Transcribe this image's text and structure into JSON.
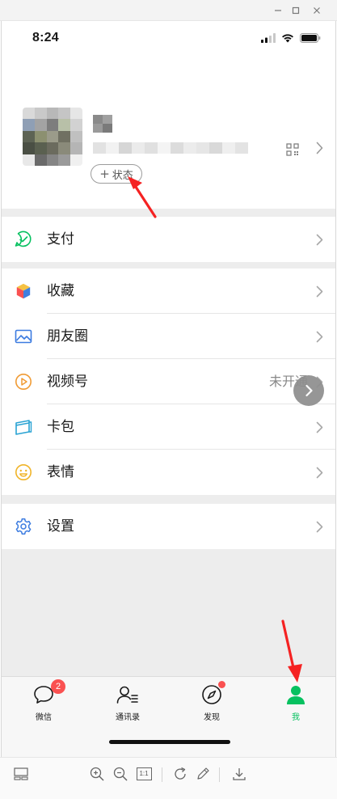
{
  "status_bar": {
    "time": "8:24"
  },
  "profile": {
    "status_button_plus": "+",
    "status_button_label": "状态"
  },
  "menu": {
    "pay": {
      "label": "支付"
    },
    "favorites": {
      "label": "收藏"
    },
    "moments": {
      "label": "朋友圈"
    },
    "channels": {
      "label": "视频号",
      "value": "未开通"
    },
    "cards": {
      "label": "卡包"
    },
    "stickers": {
      "label": "表情"
    },
    "settings": {
      "label": "设置"
    }
  },
  "tabbar": {
    "chats": {
      "label": "微信",
      "badge": "2"
    },
    "contacts": {
      "label": "通讯录"
    },
    "discover": {
      "label": "发现"
    },
    "me": {
      "label": "我"
    }
  },
  "viewer_toolbar": {
    "actual_size_label": "1:1"
  },
  "colors": {
    "accent_green": "#07c160",
    "badge_red": "#fa5151",
    "arrow_red": "#f52222"
  }
}
